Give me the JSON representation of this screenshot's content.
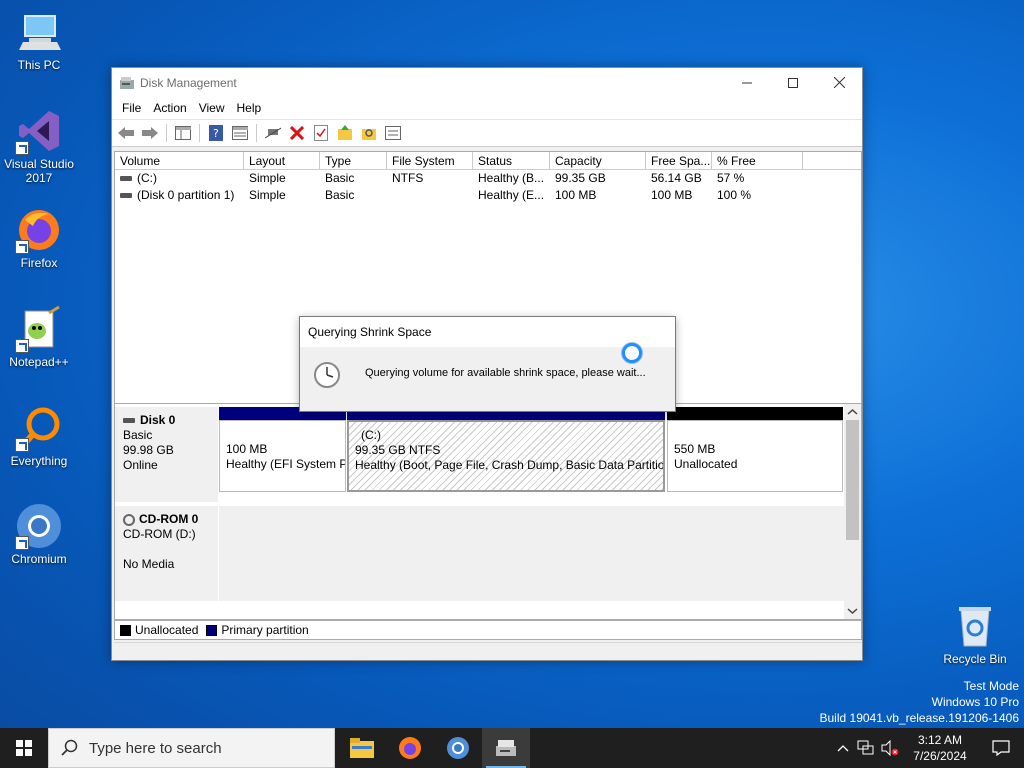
{
  "desktop": {
    "icons": [
      {
        "label": "This PC",
        "icon": "this-pc-icon"
      },
      {
        "label": "Visual Studio 2017",
        "icon": "visual-studio-icon"
      },
      {
        "label": "Firefox",
        "icon": "firefox-icon"
      },
      {
        "label": "Notepad++",
        "icon": "notepadpp-icon"
      },
      {
        "label": "Everything",
        "icon": "everything-icon"
      },
      {
        "label": "Chromium",
        "icon": "chromium-icon"
      },
      {
        "label": "Recycle Bin",
        "icon": "recycle-bin-icon"
      }
    ],
    "watermark": {
      "line1": "Test Mode",
      "line2": "Windows 10 Pro",
      "line3": "Build 19041.vb_release.191206-1406"
    }
  },
  "window": {
    "title": "Disk Management",
    "menu": [
      "File",
      "Action",
      "View",
      "Help"
    ],
    "toolbar_icons": [
      "back-icon",
      "forward-icon",
      "show-hide-console-tree-icon",
      "help-icon",
      "properties-icon",
      "connect-icon",
      "delete-icon",
      "check-icon",
      "folder-up-icon",
      "search-folder-icon",
      "console-icon"
    ]
  },
  "volume_list": {
    "columns": [
      "Volume",
      "Layout",
      "Type",
      "File System",
      "Status",
      "Capacity",
      "Free Spa...",
      "% Free"
    ],
    "rows": [
      [
        "(C:)",
        "Simple",
        "Basic",
        "NTFS",
        "Healthy (B...",
        "99.35 GB",
        "56.14 GB",
        "57 %"
      ],
      [
        "(Disk 0 partition 1)",
        "Simple",
        "Basic",
        "",
        "Healthy (E...",
        "100 MB",
        "100 MB",
        "100 %"
      ]
    ]
  },
  "disks": [
    {
      "name": "Disk 0",
      "type": "Basic",
      "size": "99.98 GB",
      "status": "Online",
      "partitions": [
        {
          "line1": "",
          "line2": "100 MB",
          "line3": "Healthy (EFI System P"
        },
        {
          "line1": "(C:)",
          "line2": "99.35 GB NTFS",
          "line3": "Healthy (Boot, Page File, Crash Dump, Basic Data Partitior"
        },
        {
          "line1": "",
          "line2": "550 MB",
          "line3": "Unallocated"
        }
      ]
    },
    {
      "name": "CD-ROM 0",
      "type": "CD-ROM (D:)",
      "size": "",
      "status": "No Media"
    }
  ],
  "legend": {
    "unallocated": "Unallocated",
    "primary": "Primary partition",
    "colors": {
      "unallocated": "#000000",
      "primary": "#00007f"
    }
  },
  "dialog": {
    "title": "Querying Shrink Space",
    "message": "Querying volume for available shrink space, please wait..."
  },
  "taskbar": {
    "search_placeholder": "Type here to search",
    "apps": [
      "file-explorer-icon",
      "firefox-icon",
      "chromium-icon",
      "disk-management-icon"
    ],
    "time": "3:12 AM",
    "date": "7/26/2024"
  }
}
